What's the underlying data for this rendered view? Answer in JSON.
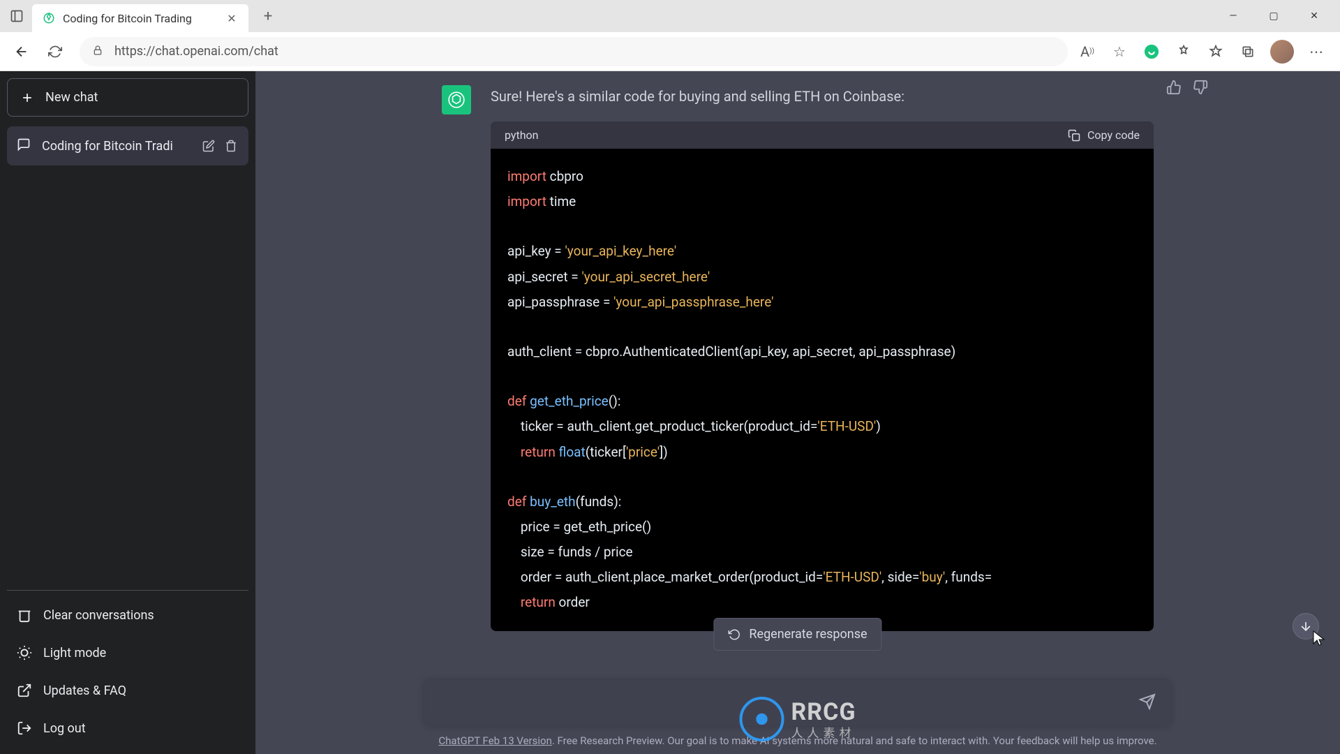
{
  "browser": {
    "tab_title": "Coding for Bitcoin Trading",
    "url": "https://chat.openai.com/chat"
  },
  "sidebar": {
    "new_chat": "New chat",
    "conversations": [
      {
        "title": "Coding for Bitcoin Tradi"
      }
    ],
    "bottom": {
      "clear": "Clear conversations",
      "light": "Light mode",
      "updates": "Updates & FAQ",
      "logout": "Log out"
    }
  },
  "chat": {
    "response_intro": "Sure! Here's a similar code for buying and selling ETH on Coinbase:",
    "code_lang": "python",
    "copy_label": "Copy code",
    "regenerate": "Regenerate response",
    "code": {
      "l1a": "import",
      "l1b": " cbpro",
      "l2a": "import",
      "l2b": " time",
      "l3": "api_key = ",
      "l3s": "'your_api_key_here'",
      "l4": "api_secret = ",
      "l4s": "'your_api_secret_here'",
      "l5": "api_passphrase = ",
      "l5s": "'your_api_passphrase_here'",
      "l6": "auth_client = cbpro.AuthenticatedClient(api_key, api_secret, api_passphrase)",
      "l7a": "def",
      "l7b": " ",
      "l7c": "get_eth_price",
      "l7d": "():",
      "l8a": "    ticker = auth_client.get_product_ticker(product_id=",
      "l8b": "'ETH-USD'",
      "l8c": ")",
      "l9a": "    ",
      "l9b": "return",
      "l9c": " ",
      "l9d": "float",
      "l9e": "(ticker[",
      "l9f": "'price'",
      "l9g": "])",
      "l10a": "def",
      "l10b": " ",
      "l10c": "buy_eth",
      "l10d": "(funds):",
      "l11": "    price = get_eth_price()",
      "l12": "    size = funds / price",
      "l13a": "    order = auth_client.place_market_order(product_id=",
      "l13b": "'ETH-USD'",
      "l13c": ", side=",
      "l13d": "'buy'",
      "l13e": ", funds=",
      "l14a": "    ",
      "l14b": "return",
      "l14c": " order"
    }
  },
  "footer": {
    "version": "ChatGPT Feb 13 Version",
    "rest": ". Free Research Preview. Our goal is to make AI systems more natural and safe to interact with. Your feedback will help us improve."
  },
  "watermark": {
    "main": "RRCG",
    "sub": "人人素材"
  }
}
